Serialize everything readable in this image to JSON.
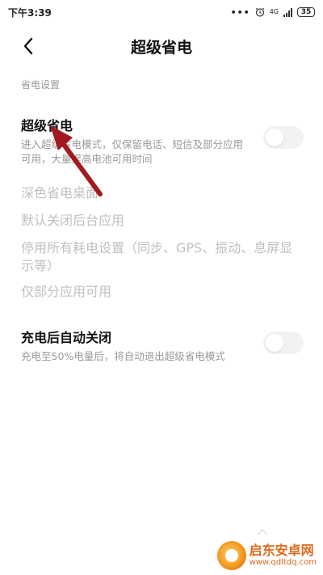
{
  "status_bar": {
    "time": "下午3:39",
    "dots": "•••",
    "network": "4G",
    "battery": "35"
  },
  "header": {
    "title": "超级省电"
  },
  "section": {
    "label": "省电设置"
  },
  "super_saver": {
    "title": "超级省电",
    "desc": "进入超级省电模式，仅保留电话、短信及部分应用可用，大量提高电池可用时间",
    "enabled": false
  },
  "options": [
    "深色省电桌面",
    "默认关闭后台应用",
    "停用所有耗电设置（同步、GPS、振动、息屏显示等）",
    "仅部分应用可用"
  ],
  "auto_close": {
    "title": "充电后自动关闭",
    "desc": "充电至50%电量后，将自动退出超级省电模式",
    "enabled": false
  },
  "watermark": {
    "name": "启东安卓网",
    "url": "www.qdltdq.com"
  },
  "colors": {
    "annotation_arrow": "#a3191f",
    "watermark": "#e06a1c"
  }
}
